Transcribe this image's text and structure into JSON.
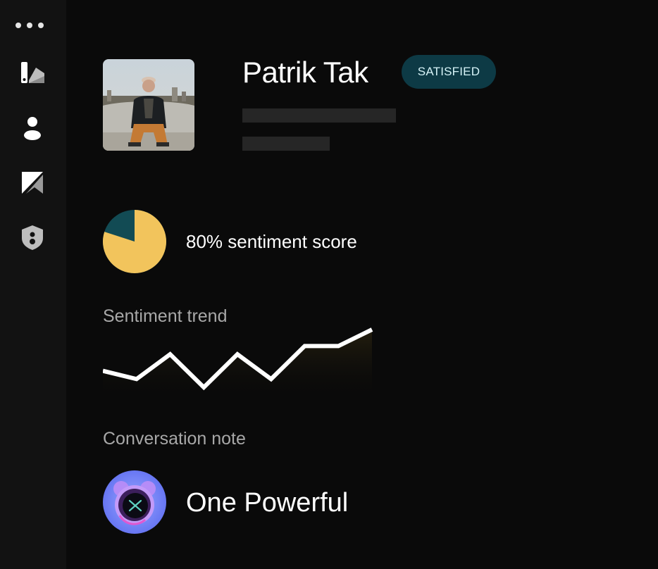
{
  "sidebar": {
    "items": [
      {
        "icon": "swatch-icon"
      },
      {
        "icon": "user-icon"
      },
      {
        "icon": "bookmark-slash-icon"
      },
      {
        "icon": "shield-user-icon"
      }
    ]
  },
  "profile": {
    "name": "Patrik Tak",
    "status": "SATISFIED",
    "status_color": "#0d3a45"
  },
  "sentiment": {
    "score_label": "80% sentiment score",
    "score_percent": 80,
    "pie_colors": {
      "primary": "#f2c45c",
      "secondary": "#124b54"
    }
  },
  "trend": {
    "title": "Sentiment trend",
    "values": [
      2,
      1,
      4,
      0,
      4,
      1,
      5,
      5,
      7
    ]
  },
  "note": {
    "title": "Conversation note",
    "text": "One Powerful"
  }
}
